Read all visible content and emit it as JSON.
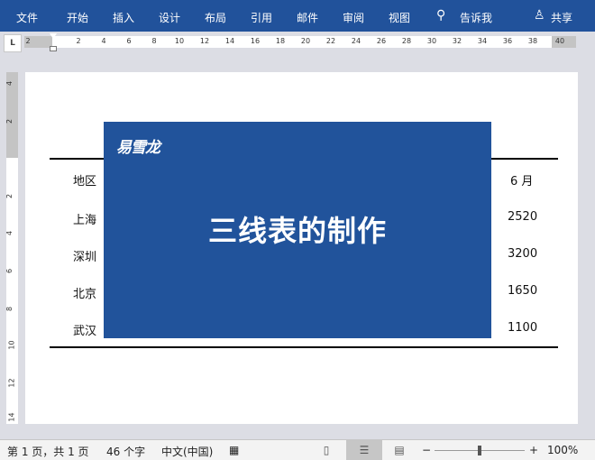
{
  "menu": [
    "文件",
    "开始",
    "插入",
    "设计",
    "布局",
    "引用",
    "邮件",
    "审阅",
    "视图"
  ],
  "tell_me": "告诉我",
  "share": "共享",
  "ruler_h": [
    "2",
    "2",
    "4",
    "6",
    "8",
    "10",
    "12",
    "14",
    "16",
    "18",
    "20",
    "22",
    "24",
    "26",
    "28",
    "30",
    "32",
    "34",
    "36",
    "38",
    "40"
  ],
  "ruler_v": [
    "4",
    "2",
    "2",
    "4",
    "6",
    "8",
    "10",
    "12",
    "14"
  ],
  "table": {
    "left": [
      "地区",
      "上海",
      "深圳",
      "北京",
      "武汉"
    ],
    "right": [
      "6 月",
      "2520",
      "3200",
      "1650",
      "1100"
    ]
  },
  "banner": {
    "logo": "易雪龙",
    "title": "三线表的制作",
    "color": "#21539b"
  },
  "status": {
    "page": "第 1 页，共 1 页",
    "words": "46 个字",
    "lang": "中文(中国)",
    "zoom": "100%",
    "minus": "−",
    "plus": "+"
  }
}
